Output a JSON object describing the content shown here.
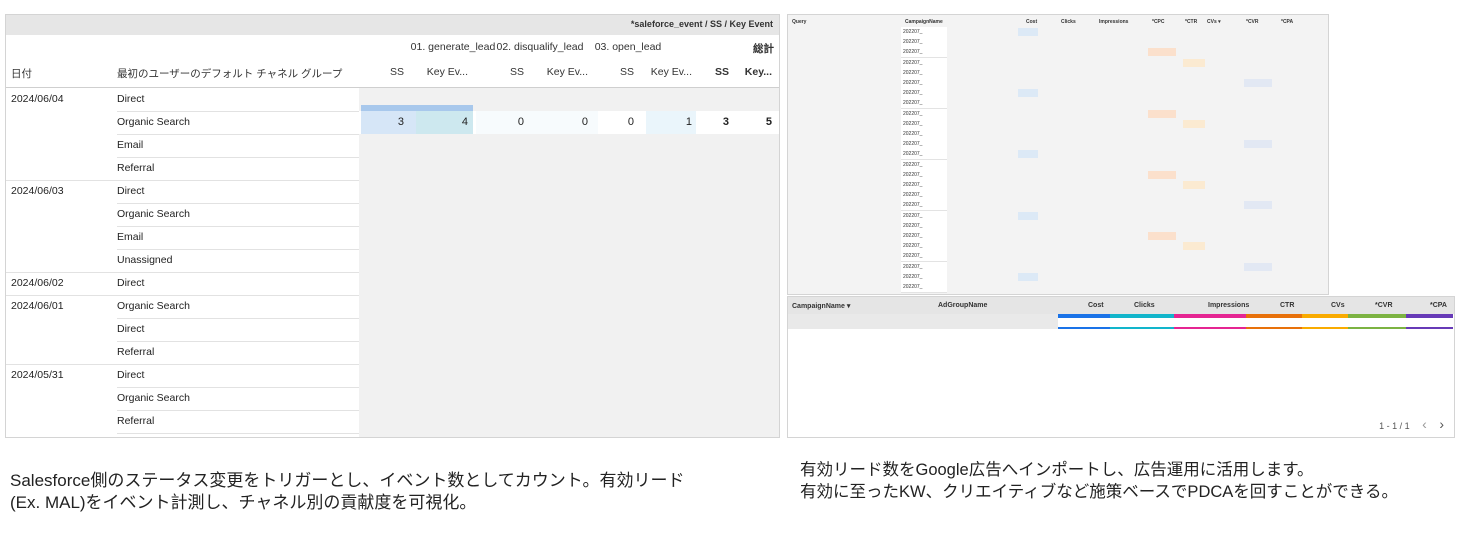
{
  "left_table": {
    "header_badge": "*saleforce_event / SS / Key Event",
    "groups": [
      "01. generate_lead",
      "02. disqualify_lead",
      "03. open_lead",
      "総計"
    ],
    "col_date": "日付",
    "col_channel": "最初のユーザーのデフォルト チャネル グループ",
    "metric_headers": [
      "SS",
      "Key Ev...",
      "SS",
      "Key Ev...",
      "SS",
      "Key Ev...",
      "SS",
      "Key..."
    ],
    "rows": [
      {
        "date": "2024/06/04",
        "channel": "Direct"
      },
      {
        "date": "",
        "channel": "Organic Search"
      },
      {
        "date": "",
        "channel": "Email"
      },
      {
        "date": "",
        "channel": "Referral"
      },
      {
        "date": "2024/06/03",
        "channel": "Direct"
      },
      {
        "date": "",
        "channel": "Organic Search"
      },
      {
        "date": "",
        "channel": "Email"
      },
      {
        "date": "",
        "channel": "Unassigned"
      },
      {
        "date": "2024/06/02",
        "channel": "Direct"
      },
      {
        "date": "2024/06/01",
        "channel": "Organic Search"
      },
      {
        "date": "",
        "channel": "Direct"
      },
      {
        "date": "",
        "channel": "Referral"
      },
      {
        "date": "2024/05/31",
        "channel": "Direct"
      },
      {
        "date": "",
        "channel": "Organic Search"
      },
      {
        "date": "",
        "channel": "Referral"
      }
    ],
    "highlight_values": [
      "3",
      "4",
      "0",
      "0",
      "0",
      "1",
      "3",
      "5"
    ]
  },
  "query_table": {
    "headers": [
      "Query",
      "CampaignName",
      "Cost",
      "Clicks",
      "Impressions",
      "*CPC",
      "*CTR",
      "CVs ▾",
      "*CVR",
      "*CPA"
    ],
    "campaign_cells": [
      "202207_",
      "202207_",
      "202207_",
      "202207_",
      "202207_",
      "202207_",
      "202207_",
      "202207_",
      "202207_",
      "202207_",
      "202207_",
      "202207_",
      "202207_",
      "202207_",
      "202207_",
      "202207_",
      "202207_",
      "202207_",
      "202207_",
      "202207_",
      "202207_",
      "202207_",
      "202207_",
      "202207_",
      "202207_",
      "202207_"
    ]
  },
  "adgroup_table": {
    "headers": [
      "CampaignName ▾",
      "AdGroupName",
      "Cost",
      "Clicks",
      "Impressions",
      "CTR",
      "CVs",
      "*CVR",
      "*CPA"
    ],
    "pagination": "1 - 1 / 1",
    "prev_icon": "‹",
    "next_icon": "›",
    "bar_colors": [
      "#1a73e8",
      "#12b5cb",
      "#e52592",
      "#e8710a",
      "#f9ab00",
      "#7cb342",
      "#673ab7"
    ]
  },
  "captions": {
    "left_line1": "Salesforce側のステータス変更をトリガーとし、イベント数としてカウント。有効リード",
    "left_line2": "(Ex. MAL)をイベント計測し、チャネル別の貢献度を可視化。",
    "right_line1": "有効リード数をGoogle広告へインポートし、広告運用に活用します。",
    "right_line2": "有効に至ったKW、クリエイティブなど施策ベースでPDCAを回すことができる。"
  }
}
